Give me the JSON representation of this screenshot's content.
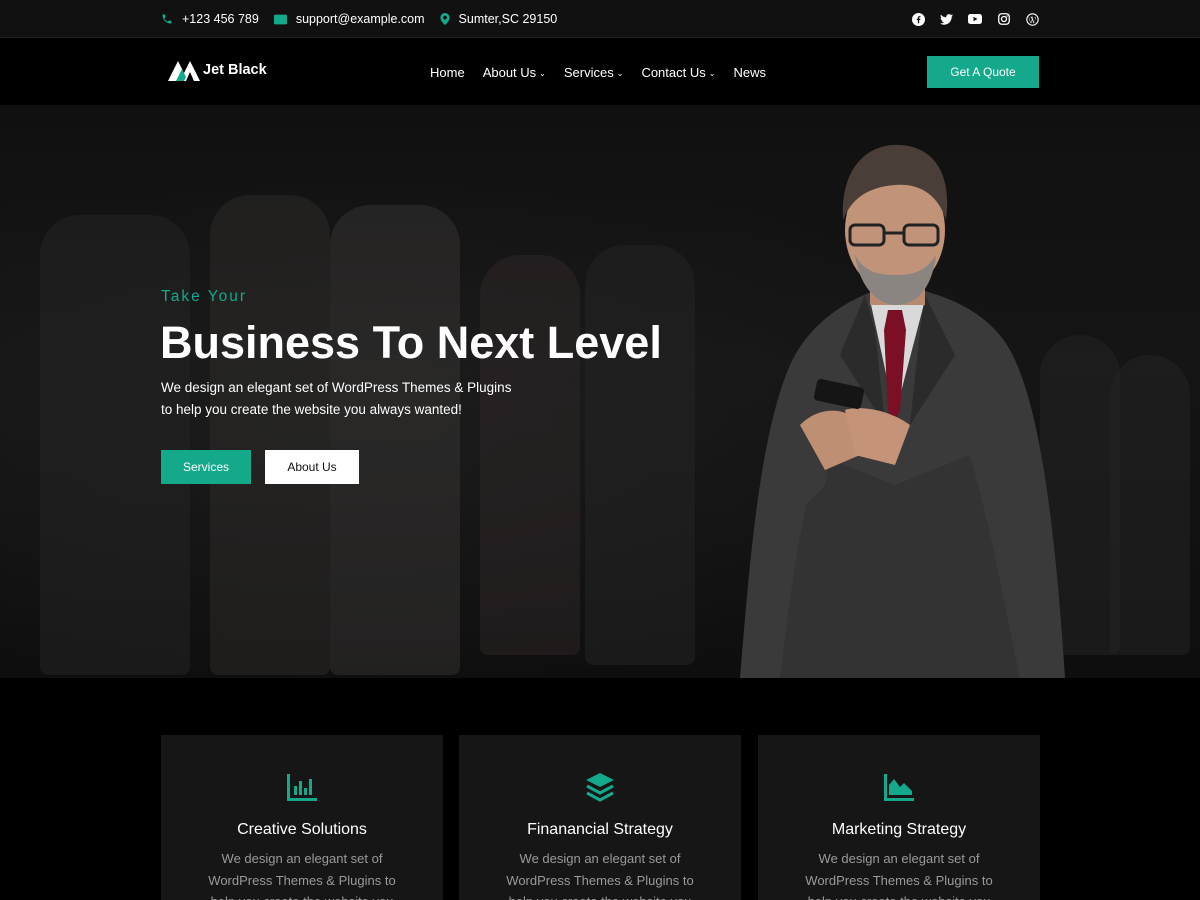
{
  "topbar": {
    "phone": "+123 456 789",
    "email": "support@example.com",
    "address": "Sumter,SC 29150",
    "social_icons": [
      "facebook-icon",
      "twitter-icon",
      "youtube-icon",
      "instagram-icon",
      "wordpress-icon"
    ]
  },
  "header": {
    "logo_text": "Jet Black",
    "nav": [
      {
        "label": "Home",
        "dropdown": false
      },
      {
        "label": "About Us",
        "dropdown": true
      },
      {
        "label": "Services",
        "dropdown": true
      },
      {
        "label": "Contact Us",
        "dropdown": true
      },
      {
        "label": "News",
        "dropdown": false
      }
    ],
    "cta_label": "Get A Quote"
  },
  "hero": {
    "eyebrow": "Take Your",
    "title": "Business To Next Level",
    "description_line1": "We design an elegant set of WordPress Themes & Plugins",
    "description_line2": "to help you create the website you always wanted!",
    "primary_button": "Services",
    "secondary_button": "About Us"
  },
  "services": {
    "cards": [
      {
        "icon": "bar-chart-icon",
        "title": "Creative Solutions",
        "text": "We design an elegant set of WordPress Themes & Plugins to help you create the website you"
      },
      {
        "icon": "layers-icon",
        "title": "Finanancial Strategy",
        "text": "We design an elegant set of WordPress Themes & Plugins to help you create the website you"
      },
      {
        "icon": "area-chart-icon",
        "title": "Marketing Strategy",
        "text": "We design an elegant set of WordPress Themes & Plugins to help you create the website you"
      }
    ]
  },
  "colors": {
    "accent": "#14a98b",
    "background": "#000000",
    "card": "#161616",
    "topbar": "#111111"
  }
}
